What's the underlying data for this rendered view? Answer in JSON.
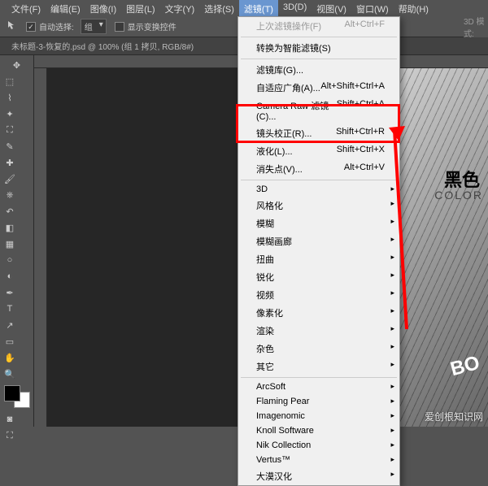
{
  "menubar": {
    "items": [
      "文件(F)",
      "编辑(E)",
      "图像(I)",
      "图层(L)",
      "文字(Y)",
      "选择(S)",
      "滤镜(T)",
      "3D(D)",
      "视图(V)",
      "窗口(W)",
      "帮助(H)"
    ],
    "active_index": 6
  },
  "options_bar": {
    "auto_select_label": "自动选择:",
    "group_label": "组",
    "transform_label": "显示变换控件",
    "mode_label": "3D 模式:"
  },
  "document_tab": {
    "title": "未标题-3-恢复的.psd @ 100% (组 1 拷贝, RGB/8#)"
  },
  "filter_menu": {
    "last_filter": {
      "label": "上次滤镜操作(F)",
      "shortcut": "Alt+Ctrl+F"
    },
    "smart_filter": {
      "label": "转换为智能滤镜(S)"
    },
    "filter_gallery": {
      "label": "滤镜库(G)..."
    },
    "adaptive_wide": {
      "label": "自适应广角(A)...",
      "shortcut": "Alt+Shift+Ctrl+A"
    },
    "camera_raw": {
      "label": "Camera Raw 滤镜(C)...",
      "shortcut": "Shift+Ctrl+A"
    },
    "lens_correction": {
      "label": "镜头校正(R)...",
      "shortcut": "Shift+Ctrl+R"
    },
    "liquify": {
      "label": "液化(L)...",
      "shortcut": "Shift+Ctrl+X"
    },
    "vanishing": {
      "label": "消失点(V)...",
      "shortcut": "Alt+Ctrl+V"
    },
    "sub_3d": "3D",
    "stylize": "风格化",
    "blur": "模糊",
    "blur_gallery": "模糊画廊",
    "distort": "扭曲",
    "sharpen": "锐化",
    "video": "视频",
    "pixelate": "像素化",
    "render": "渲染",
    "noise": "杂色",
    "other": "其它",
    "arcsoft": "ArcSoft",
    "flaming_pear": "Flaming Pear",
    "imagenomic": "Imagenomic",
    "knoll": "Knoll Software",
    "nik": "Nik Collection",
    "vertus": "Vertus™",
    "damo": "大漠汉化"
  },
  "canvas": {
    "black_text": "黑色",
    "color_text": "COLOR",
    "box_text": "BO"
  },
  "watermark": "爱创根知识网"
}
